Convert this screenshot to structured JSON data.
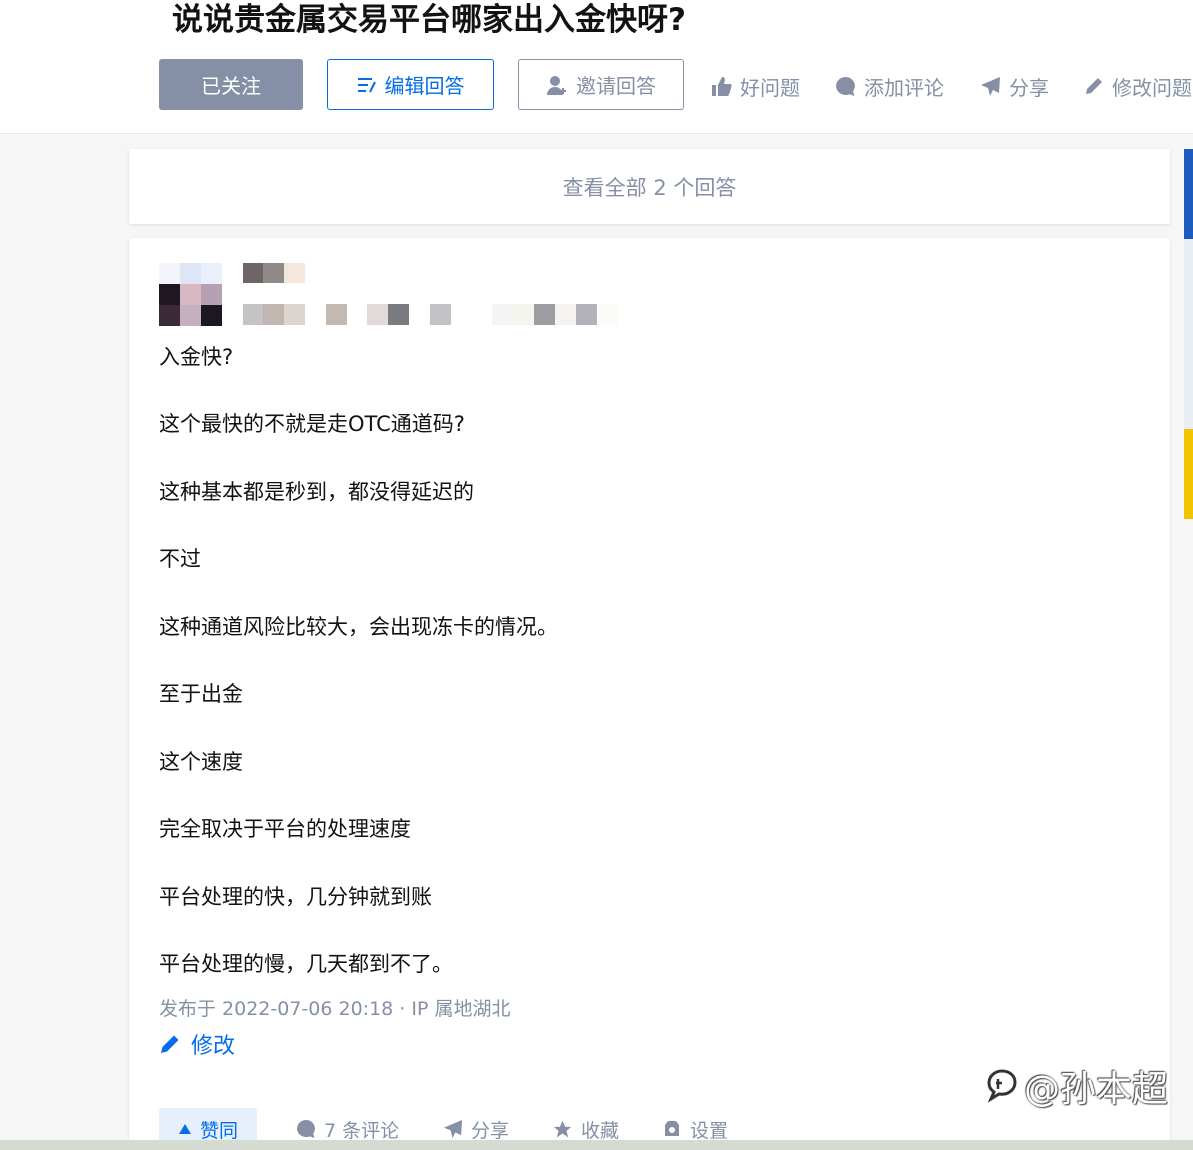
{
  "question": {
    "title": "说说贵金属交易平台哪家出入金快呀?",
    "buttons": {
      "follow": "已关注",
      "edit_answer": "编辑回答",
      "invite": "邀请回答"
    },
    "actions": {
      "good_question": "好问题",
      "add_comment": "添加评论",
      "share": "分享",
      "edit_question": "修改问题"
    }
  },
  "view_all": "查看全部 2 个回答",
  "answer": {
    "paragraphs": [
      "入金快?",
      "这个最快的不就是走OTC通道码?",
      "这种基本都是秒到，都没得延迟的",
      "不过",
      "这种通道风险比较大，会出现冻卡的情况。",
      "至于出金",
      "这个速度",
      "完全取决于平台的处理速度",
      "平台处理的快，几分钟就到账",
      "平台处理的慢，几天都到不了。"
    ],
    "meta": "发布于 2022-07-06 20:18 · IP 属地湖北",
    "edit_label": "修改",
    "footer": {
      "vote": "赞同",
      "comments": "7 条评论",
      "share": "分享",
      "collect": "收藏",
      "settings": "设置"
    }
  },
  "watermark": "@孙本超",
  "colors": {
    "primary": "#056de8",
    "muted": "#8590a6",
    "text": "#121212",
    "background": "#f6f6f6"
  },
  "icons": [
    "edit-answer-icon",
    "invite-icon",
    "thumb-up-icon",
    "comment-icon",
    "share-icon",
    "pencil-icon",
    "upvote-icon",
    "star-icon",
    "gear-icon",
    "zhihu-logo-icon"
  ]
}
